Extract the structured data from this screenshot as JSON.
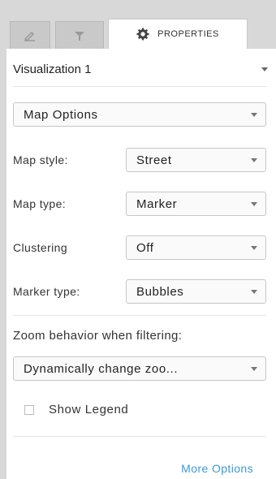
{
  "tabs": {
    "edit_icon": "pencil-icon",
    "filter_icon": "filter-icon",
    "properties_icon": "gear-icon",
    "properties_label": "PROPERTIES"
  },
  "visualization": {
    "label": "Visualization 1"
  },
  "map_options": {
    "value": "Map Options"
  },
  "fields": {
    "map_style": {
      "label": "Map style:",
      "value": "Street"
    },
    "map_type": {
      "label": "Map type:",
      "value": "Marker"
    },
    "clustering": {
      "label": "Clustering",
      "value": "Off"
    },
    "marker_type": {
      "label": "Marker type:",
      "value": "Bubbles"
    }
  },
  "zoom": {
    "label": "Zoom behavior when filtering:",
    "value": "Dynamically change zoo..."
  },
  "legend": {
    "label": "Show Legend",
    "checked": false
  },
  "more_options": {
    "label": "More Options"
  },
  "colors": {
    "link": "#3b9ad9",
    "tab_bg": "#d8d8d8"
  }
}
